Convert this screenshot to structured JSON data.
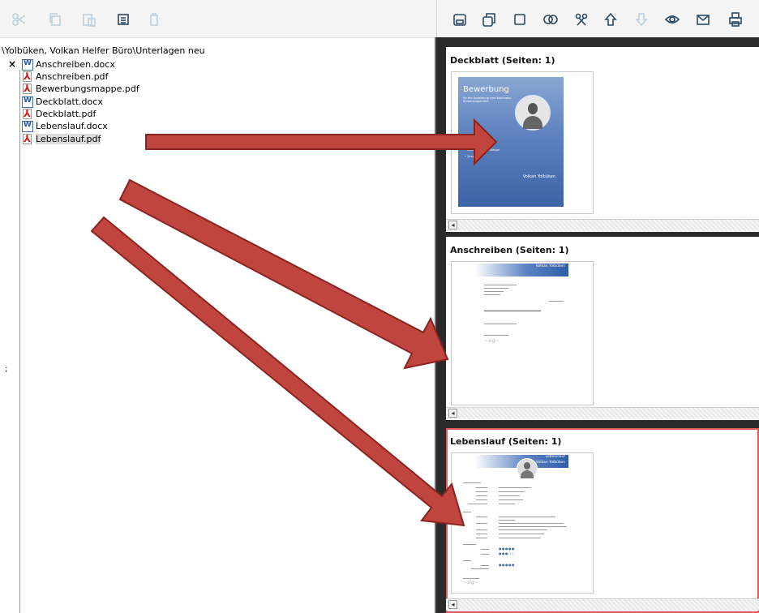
{
  "left_toolbar": {
    "buttons": [
      {
        "icon": "scissors-icon",
        "label": "Cut",
        "state": "disabled"
      },
      {
        "icon": "copy-icon",
        "label": "Copy",
        "state": "disabled"
      },
      {
        "icon": "paste-icon",
        "label": "Paste",
        "state": "disabled"
      },
      {
        "icon": "calculator-icon",
        "label": "Properties",
        "state": "enabled"
      },
      {
        "icon": "trash-icon",
        "label": "Delete",
        "state": "disabled"
      }
    ]
  },
  "right_toolbar": {
    "buttons": [
      {
        "icon": "save-icon"
      },
      {
        "icon": "save-as-icon"
      },
      {
        "icon": "square-icon"
      },
      {
        "icon": "merge-circles-icon"
      },
      {
        "icon": "cut-tool-icon"
      },
      {
        "icon": "arrow-up-icon"
      },
      {
        "icon": "arrow-down-icon",
        "state": "disabled"
      },
      {
        "icon": "eye-icon"
      },
      {
        "icon": "mail-icon"
      },
      {
        "icon": "print-icon"
      }
    ]
  },
  "path": "\\Yolbüken, Volkan Helfer Büro\\Unterlagen neu",
  "close_label": "×",
  "side_mark": ";",
  "files": [
    {
      "name": "Anschreiben.docx",
      "type": "docx"
    },
    {
      "name": "Anschreiben.pdf",
      "type": "pdf"
    },
    {
      "name": "Bewerbungsmappe.pdf",
      "type": "pdf"
    },
    {
      "name": "Deckblatt.docx",
      "type": "docx"
    },
    {
      "name": "Deckblatt.pdf",
      "type": "pdf"
    },
    {
      "name": "Lebenslauf.docx",
      "type": "docx"
    },
    {
      "name": "Lebenslauf.pdf",
      "type": "pdf",
      "selected": true
    }
  ],
  "sections": [
    {
      "title": "Deckblatt (Seiten: 1)"
    },
    {
      "title": "Anschreiben (Seiten: 1)"
    },
    {
      "title": "Lebenslauf (Seiten: 1)",
      "active": true
    }
  ],
  "cover": {
    "title": "Bewerbung",
    "subtitle": "für die Ausbildung zum Kaufmann Büromanagement",
    "bullets": [
      "• Anschreiben",
      "• Lebenslauf & Anhänge",
      "• Zeugnisse"
    ],
    "name": "Volkan Yolbüken"
  },
  "letter_header_name": "Volkan Yolbüken",
  "cv_header_title": "Lebenslauf",
  "cv_header_name": "Volkan Yolbüken",
  "scroll_left": "◂",
  "colors": {
    "accent_red": "#c0392b",
    "cover_blue": "#4a6fb0",
    "panel_dark": "#2a2a2a"
  }
}
